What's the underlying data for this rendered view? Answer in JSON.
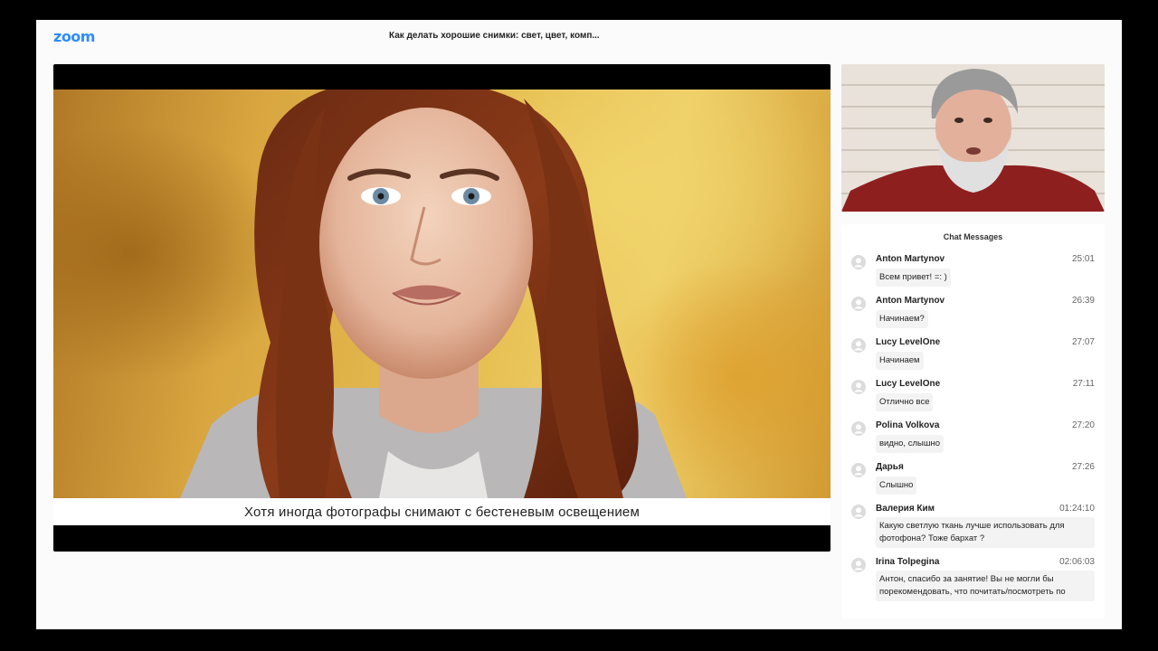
{
  "app": {
    "logo": "zoom",
    "meeting_title": "Как делать хорошие снимки: свет, цвет, комп..."
  },
  "presentation": {
    "subtitle": "Хотя иногда фотографы снимают с бестеневым освещением"
  },
  "chat": {
    "header": "Chat Messages",
    "messages": [
      {
        "name": "Anton Martynov",
        "time": "25:01",
        "text": "Всем привет! =: )"
      },
      {
        "name": "Anton Martynov",
        "time": "26:39",
        "text": "Начинаем?"
      },
      {
        "name": "Lucy LevelOne",
        "time": "27:07",
        "text": "Начинаем"
      },
      {
        "name": "Lucy LevelOne",
        "time": "27:11",
        "text": "Отлично все"
      },
      {
        "name": "Polina Volkova",
        "time": "27:20",
        "text": "видно, слышно"
      },
      {
        "name": "Дарья",
        "time": "27:26",
        "text": "Слышно"
      },
      {
        "name": "Валерия Ким",
        "time": "01:24:10",
        "text": "Какую светлую ткань лучше использовать для фотофона? Тоже бархат ?"
      },
      {
        "name": "Irina Tolpegina",
        "time": "02:06:03",
        "text": "Антон, спасибо за занятие! Вы не могли бы порекомендовать, что почитать/посмотреть по"
      }
    ]
  },
  "colors": {
    "brand": "#2d8cff",
    "background": "#fbfbfb",
    "letterbox": "#000000"
  }
}
